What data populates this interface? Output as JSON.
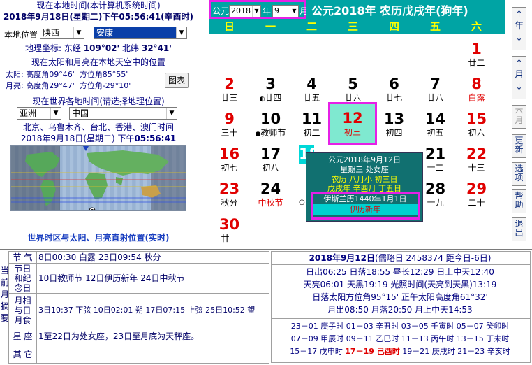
{
  "left": {
    "local_time_title": "现在本地时间(本计算机系统时间)",
    "local_time_value": "2018年9月18日(星期二)下午05:56:41(辛酉时)",
    "location_label": "本地位置",
    "province": "陕西",
    "city": "安康",
    "geo_label": "地理坐标:",
    "longitude_label": "东经",
    "longitude": "109°02'",
    "latitude_label": "北纬",
    "latitude": "32°41'",
    "sunmoon_title": "现在太阳和月亮在本地天空中的位置",
    "sun_label": "太阳:",
    "sun_alt_label": "高度角",
    "sun_alt": "09°46'",
    "sun_az_label": "方位角",
    "sun_az": "85°55'",
    "moon_label": "月亮:",
    "moon_alt_label": "高度角",
    "moon_alt": "29°47'",
    "moon_az_label": "方位角",
    "moon_az": "-29°10'",
    "chart_button": "图表",
    "world_title": "现在世界各地时间(请选择地理位置)",
    "region": "亚洲",
    "country": "中国",
    "cities": "北京、乌鲁木齐、台北、香港、澳门时间",
    "world_time_prefix": "2018年9月18日(星期二) 下午",
    "world_time_clock": "05:56:41",
    "map_caption_prefix": "世界时区与太阳、月亮直射位置",
    "map_caption_suffix": "(实时)"
  },
  "header": {
    "era_label": "公元",
    "year_value": "2018",
    "year_label": "年",
    "month_value": "9",
    "month_label": "月",
    "title": "公元2018年  农历戊戌年(狗年)"
  },
  "weekdays": [
    "日",
    "一",
    "二",
    "三",
    "四",
    "五",
    "六"
  ],
  "days": {
    "d1": {
      "num": "1",
      "lunar": "廿二"
    },
    "d2": {
      "num": "2",
      "lunar": "廿三"
    },
    "d3": {
      "num": "3",
      "lunar": "廿四"
    },
    "d4": {
      "num": "4",
      "lunar": "廿五"
    },
    "d5": {
      "num": "5",
      "lunar": "廿六"
    },
    "d6": {
      "num": "6",
      "lunar": "廿七"
    },
    "d7": {
      "num": "7",
      "lunar": "廿八"
    },
    "d8": {
      "num": "8",
      "lunar": "白露"
    },
    "d9": {
      "num": "9",
      "lunar": "三十"
    },
    "d10": {
      "num": "10",
      "lunar": "教师节"
    },
    "d11": {
      "num": "11",
      "lunar": "初二"
    },
    "d12": {
      "num": "12",
      "lunar": "初三"
    },
    "d13": {
      "num": "13",
      "lunar": "初四"
    },
    "d14": {
      "num": "14",
      "lunar": "初五"
    },
    "d15": {
      "num": "15",
      "lunar": "初六"
    },
    "d16": {
      "num": "16",
      "lunar": "初七"
    },
    "d17": {
      "num": "17",
      "lunar": "初八"
    },
    "d18": {
      "num": "18",
      "lunar": ""
    },
    "d21": {
      "num": "21",
      "lunar": "十二"
    },
    "d22": {
      "num": "22",
      "lunar": "十三"
    },
    "d23": {
      "num": "23",
      "lunar": "秋分"
    },
    "d24": {
      "num": "24",
      "lunar": "中秋节"
    },
    "d28": {
      "num": "28",
      "lunar": "十九"
    },
    "d29": {
      "num": "29",
      "lunar": "二十"
    },
    "d30": {
      "num": "30",
      "lunar": "廿一"
    }
  },
  "tooltip": {
    "line1": "公元2018年9月12日",
    "line2": "星期三  处女座",
    "line3": "农历  八月小  初三日",
    "line4": "戊戌年  辛酉月  丁丑日",
    "line5": "伊斯兰历1440年1月1日",
    "line6": "伊历新年"
  },
  "side": {
    "year_up": "↑",
    "year_label": "年",
    "year_down": "↓",
    "month_up": "↑",
    "month_label": "月",
    "month_down": "↓",
    "this_month": "本月",
    "refresh": "更新",
    "options": "选项",
    "help": "帮助",
    "exit": "退出"
  },
  "info": {
    "side_label": "当前月摘要",
    "jieqi_label": "节  气",
    "jieqi": "8日00:30 白露    23日09:54 秋分",
    "holiday_label": "节日和纪念日",
    "holidays": "10日教师节 12日伊历新年 24日中秋节",
    "moon_label": "月相与日月食",
    "moon": "3日10:37 下弦  10日02:01 朔  17日07:15 上弦  25日10:52 望",
    "xingzuo_label": "星  座",
    "xingzuo": "1至22日为处女座，23日至月底为天秤座。",
    "other_label": "其  它",
    "other": ""
  },
  "right_info": {
    "date": "2018年9月12日",
    "julian": "(儒略日 2458374  距今日-6日)",
    "line1": "日出06:25  日落18:55  昼长12:29  日上中天12:40",
    "line2": "天亮06:01  天黑19:19  光照时间(天亮到天黑)13:19",
    "line3": "日落太阳方位角95°15'  正午太阳高度角61°32'",
    "line4": "月出08:50    月落20:50    月上中天14:53",
    "hours1": "23－01 庚子时   01－03 辛丑时   03－05 壬寅时   05－07 癸卯时",
    "hours2": "07－09 甲辰时   09－11 乙巳时   11－13 丙午时   13－15 丁未时",
    "hours3a": "15－17 戊申时   ",
    "hours3b": "17－19 己酉时",
    "hours3c": "   19－21 庚戌时   21－23 辛亥时"
  }
}
